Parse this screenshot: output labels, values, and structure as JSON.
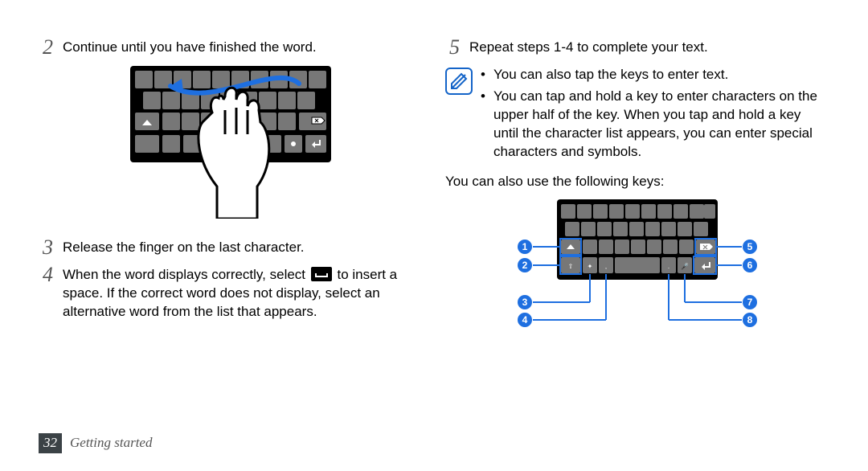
{
  "left": {
    "step2_num": "2",
    "step2": "Continue until you have finished the word.",
    "step3_num": "3",
    "step3": "Release the finger on the last character.",
    "step4_num": "4",
    "step4_before": "When the word displays correctly, select ",
    "step4_after": " to insert a space. If the correct word does not display, select an alternative word from the list that appears.",
    "space_icon_name": "space-key-icon"
  },
  "right": {
    "step5_num": "5",
    "step5": "Repeat steps 1-4 to complete your text.",
    "note_bullet1": "You can also tap the keys to enter text.",
    "note_bullet2": "You can tap and hold a key to enter characters on the upper half of the key. When you tap and hold a key until the character list appears, you can enter special characters and symbols.",
    "following_keys": "You can also use the following keys:",
    "callouts": {
      "1": "1",
      "2": "2",
      "3": "3",
      "4": "4",
      "5": "5",
      "6": "6",
      "7": "7",
      "8": "8"
    }
  },
  "footer": {
    "page": "32",
    "section": "Getting started"
  }
}
